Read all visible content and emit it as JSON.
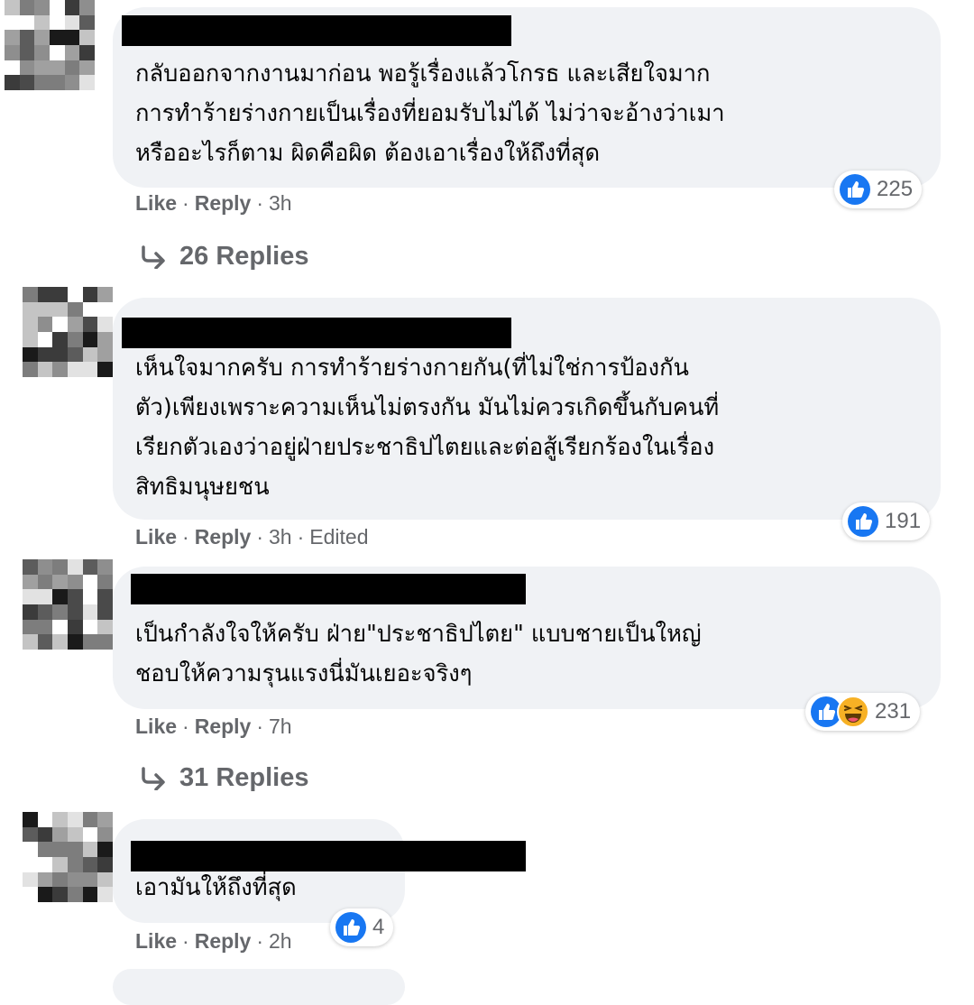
{
  "colors": {
    "bubble": "#f0f2f5",
    "meta": "#65676b",
    "like_blue": "#1877f2",
    "haha_yellow": "#f7b125"
  },
  "comments": [
    {
      "text": "กลับออกจากงานมาก่อน พอรู้เรื่องแล้วโกรธ และเสียใจมาก\nการทำร้ายร่างกายเป็นเรื่องที่ยอมรับไม่ได้ ไม่ว่าจะอ้างว่าเมา\nหรืออะไรก็ตาม ผิดคือผิด ต้องเอาเรื่องให้ถึงที่สุด",
      "like": "Like",
      "reply": "Reply",
      "time": "3h",
      "edited": "",
      "reactions": [
        "like-icon"
      ],
      "count": "225",
      "replies_label": "26 Replies"
    },
    {
      "text": "เห็นใจมากครับ การทำร้ายร่างกายกัน(ที่ไม่ใช่การป้องกัน\nตัว)เพียงเพราะความเห็นไม่ตรงกัน มันไม่ควรเกิดขึ้นกับคนที่\nเรียกตัวเองว่าอยู่ฝ่ายประชาธิปไตยและต่อสู้เรียกร้องในเรื่อง\nสิทธิมนุษยชน",
      "like": "Like",
      "reply": "Reply",
      "time": "3h",
      "edited": "Edited",
      "reactions": [
        "like-icon"
      ],
      "count": "191",
      "replies_label": ""
    },
    {
      "text": "เป็นกำลังใจให้ครับ ฝ่าย\"ประชาธิปไตย\" แบบชายเป็นใหญ่\nชอบให้ความรุนแรงนี่มันเยอะจริงๆ",
      "like": "Like",
      "reply": "Reply",
      "time": "7h",
      "edited": "",
      "reactions": [
        "like-icon",
        "haha-icon"
      ],
      "count": "231",
      "replies_label": "31 Replies"
    },
    {
      "text": "เอามันให้ถึงที่สุด",
      "like": "Like",
      "reply": "Reply",
      "time": "2h",
      "edited": "",
      "reactions": [
        "like-icon"
      ],
      "count": "4",
      "replies_label": ""
    }
  ],
  "icons": {
    "reply_arrow": "reply-arrow-icon",
    "avatar": "pixelated-avatar"
  }
}
